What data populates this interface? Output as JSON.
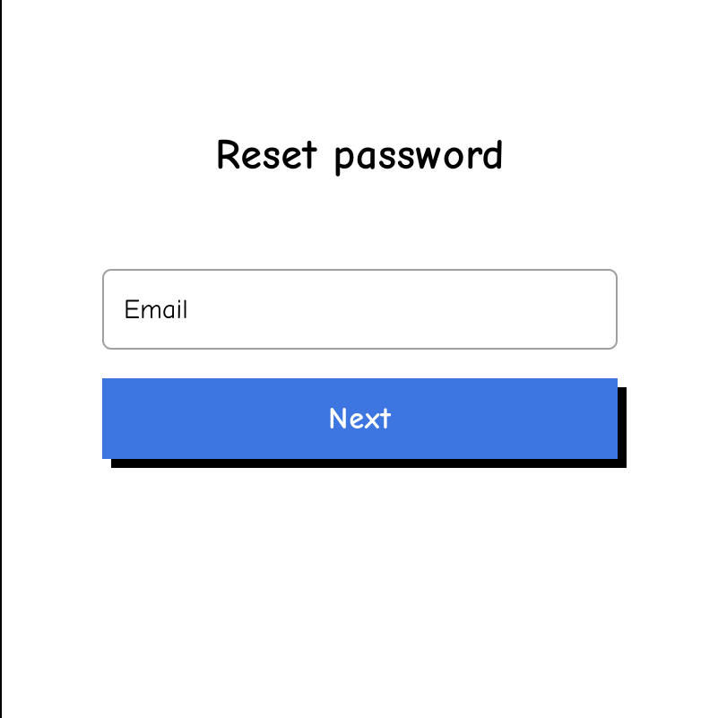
{
  "title": "Reset password",
  "form": {
    "email_placeholder": "Email",
    "email_value": "",
    "next_label": "Next"
  },
  "colors": {
    "button_bg": "#3d76e0",
    "button_text": "#ffffff",
    "input_border": "#a0a0a0",
    "shadow": "#000000"
  }
}
